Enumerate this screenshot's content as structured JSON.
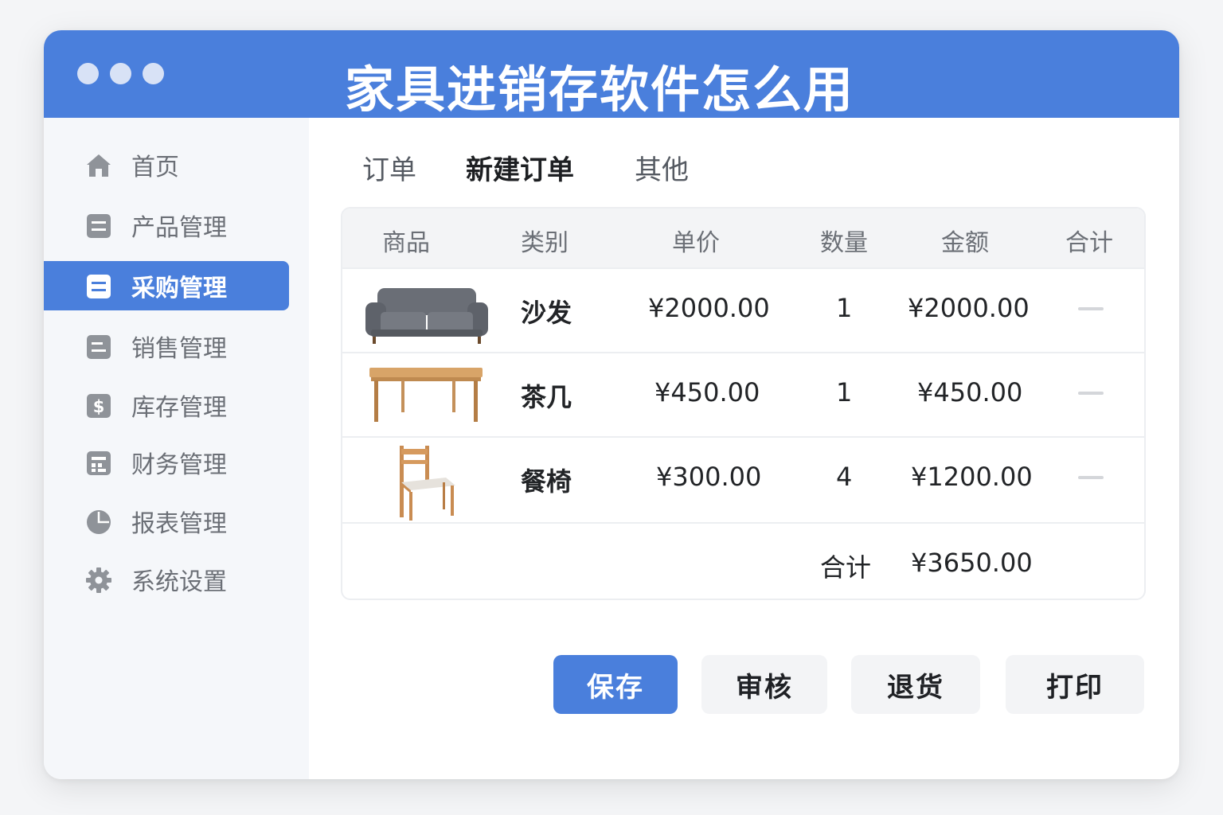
{
  "window": {
    "title": "家具进销存软件怎么用"
  },
  "sidebar": {
    "items": [
      {
        "label": "首页",
        "icon": "home-icon"
      },
      {
        "label": "产品管理",
        "icon": "list-icon"
      },
      {
        "label": "采购管理",
        "icon": "list-icon",
        "active": true
      },
      {
        "label": "销售管理",
        "icon": "list-icon"
      },
      {
        "label": "库存管理",
        "icon": "dollar-icon"
      },
      {
        "label": "财务管理",
        "icon": "register-icon"
      },
      {
        "label": "报表管理",
        "icon": "pie-chart-icon"
      },
      {
        "label": "系统设置",
        "icon": "gear-icon"
      }
    ]
  },
  "tabs": [
    {
      "label": "订单"
    },
    {
      "label": "新建订单",
      "active": true
    },
    {
      "label": "其他"
    }
  ],
  "table": {
    "headers": [
      "商品",
      "类别",
      "单价",
      "数量",
      "金额",
      "合计"
    ],
    "rows": [
      {
        "image": "sofa-image",
        "name": "沙发",
        "price": "¥2000.00",
        "qty": "1",
        "amount": "¥2000.00"
      },
      {
        "image": "table-image",
        "name": "茶几",
        "price": "¥450.00",
        "qty": "1",
        "amount": "¥450.00"
      },
      {
        "image": "chair-image",
        "name": "餐椅",
        "price": "¥300.00",
        "qty": "4",
        "amount": "¥1200.00"
      }
    ],
    "total_label": "合计",
    "total_value": "¥3650.00"
  },
  "buttons": {
    "save": "保存",
    "review": "审核",
    "return": "退货",
    "print": "打印"
  },
  "colors": {
    "accent": "#4a7fdc",
    "sidebar_bg": "#f5f7fa",
    "icon_gray": "#8f9399"
  }
}
